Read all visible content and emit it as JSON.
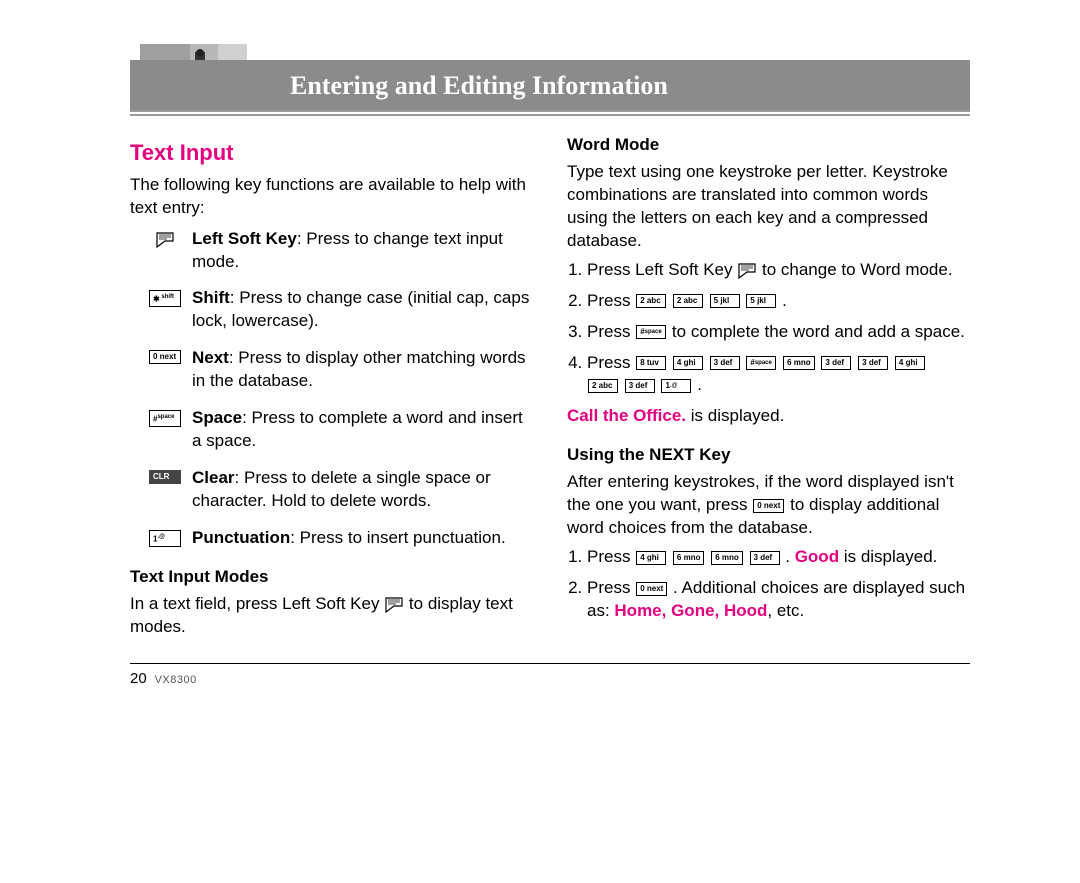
{
  "header": {
    "title": "Entering and Editing Information"
  },
  "left": {
    "section_title": "Text Input",
    "intro": "The following key functions are available to help with text entry:",
    "keys": [
      {
        "icon": "softkey",
        "bold": "Left Soft Key",
        "text": ": Press to change text input mode."
      },
      {
        "icon": "star",
        "bold": "Shift",
        "text": ": Press to change case (initial cap, caps lock, lowercase)."
      },
      {
        "icon": "0next",
        "bold": "Next",
        "text": ": Press to display other matching words in the database."
      },
      {
        "icon": "hash",
        "bold": "Space",
        "text": ": Press to complete a word and insert a space."
      },
      {
        "icon": "clr",
        "bold": "Clear",
        "text": ": Press to delete a single space or character. Hold to delete words."
      },
      {
        "icon": "1punct",
        "bold": "Punctuation",
        "text": ": Press to insert punctuation."
      }
    ],
    "modes_heading": "Text Input Modes",
    "modes_text_a": "In a text field, press Left Soft Key ",
    "modes_text_b": " to display text modes."
  },
  "right": {
    "word_heading": "Word Mode",
    "word_intro": "Type text using one keystroke per letter. Keystroke combinations are translated into common words using the letters on each key and a compressed database.",
    "step1_a": "Press Left Soft Key ",
    "step1_b": " to change to Word mode.",
    "step2_a": "Press ",
    "step2_b": ".",
    "step3_a": "Press ",
    "step3_b": " to complete the word and add a space.",
    "step4_a": "Press ",
    "step4_b": ".",
    "result_bold": "Call the Office.",
    "result_tail": " is displayed.",
    "next_heading": "Using the NEXT Key",
    "next_intro_a": "After entering keystrokes, if the word displayed isn't the one you want, press ",
    "next_intro_b": " to display additional word choices from the database.",
    "nstep1_a": "Press ",
    "nstep1_b": ". ",
    "nstep1_bold": "Good",
    "nstep1_c": " is displayed.",
    "nstep2_a": "Press ",
    "nstep2_b": ". Additional choices are displayed such as: ",
    "nstep2_words": "Home, Gone, Hood",
    "nstep2_c": ", etc."
  },
  "keycaps": {
    "star": "✱",
    "zero_next": "0 next",
    "hash_space": "#",
    "clr": "CLR",
    "one": "1",
    "two_abc": "2 abc",
    "three_def": "3 def",
    "four_ghi": "4 ghi",
    "five_jkl": "5 jkl",
    "six_mno": "6 mno",
    "eight_tuv": "8 tuv"
  },
  "footer": {
    "page": "20",
    "model": "VX8300"
  }
}
